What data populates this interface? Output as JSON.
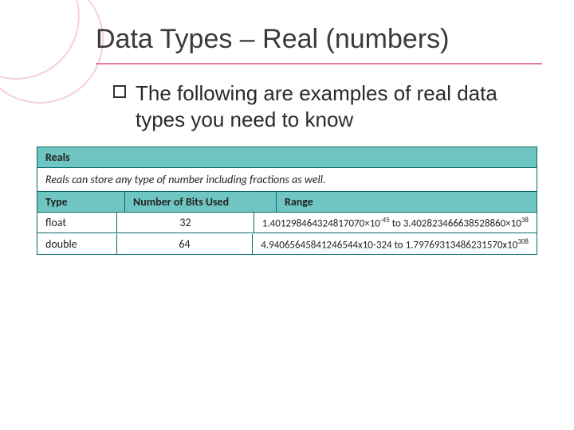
{
  "title": "Data Types – Real (numbers)",
  "body": "The following are examples of real data types you need to know",
  "table": {
    "section": "Reals",
    "note": "Reals can store any type of number including fractions as well.",
    "headers": {
      "type": "Type",
      "bits": "Number of Bits Used",
      "range": "Range"
    },
    "rows": [
      {
        "type": "float",
        "bits": "32",
        "low_base": "1.401298464324817070×10",
        "low_exp": "-45",
        "high_base": "3.402823466638528860×10",
        "high_exp": "38",
        "sep": " to "
      },
      {
        "type": "double",
        "bits": "64",
        "low_base": "4.94065645841246544x10-324",
        "low_exp": "",
        "high_base": "1.79769313486231570x10",
        "high_exp": "308",
        "sep": " to "
      }
    ]
  }
}
